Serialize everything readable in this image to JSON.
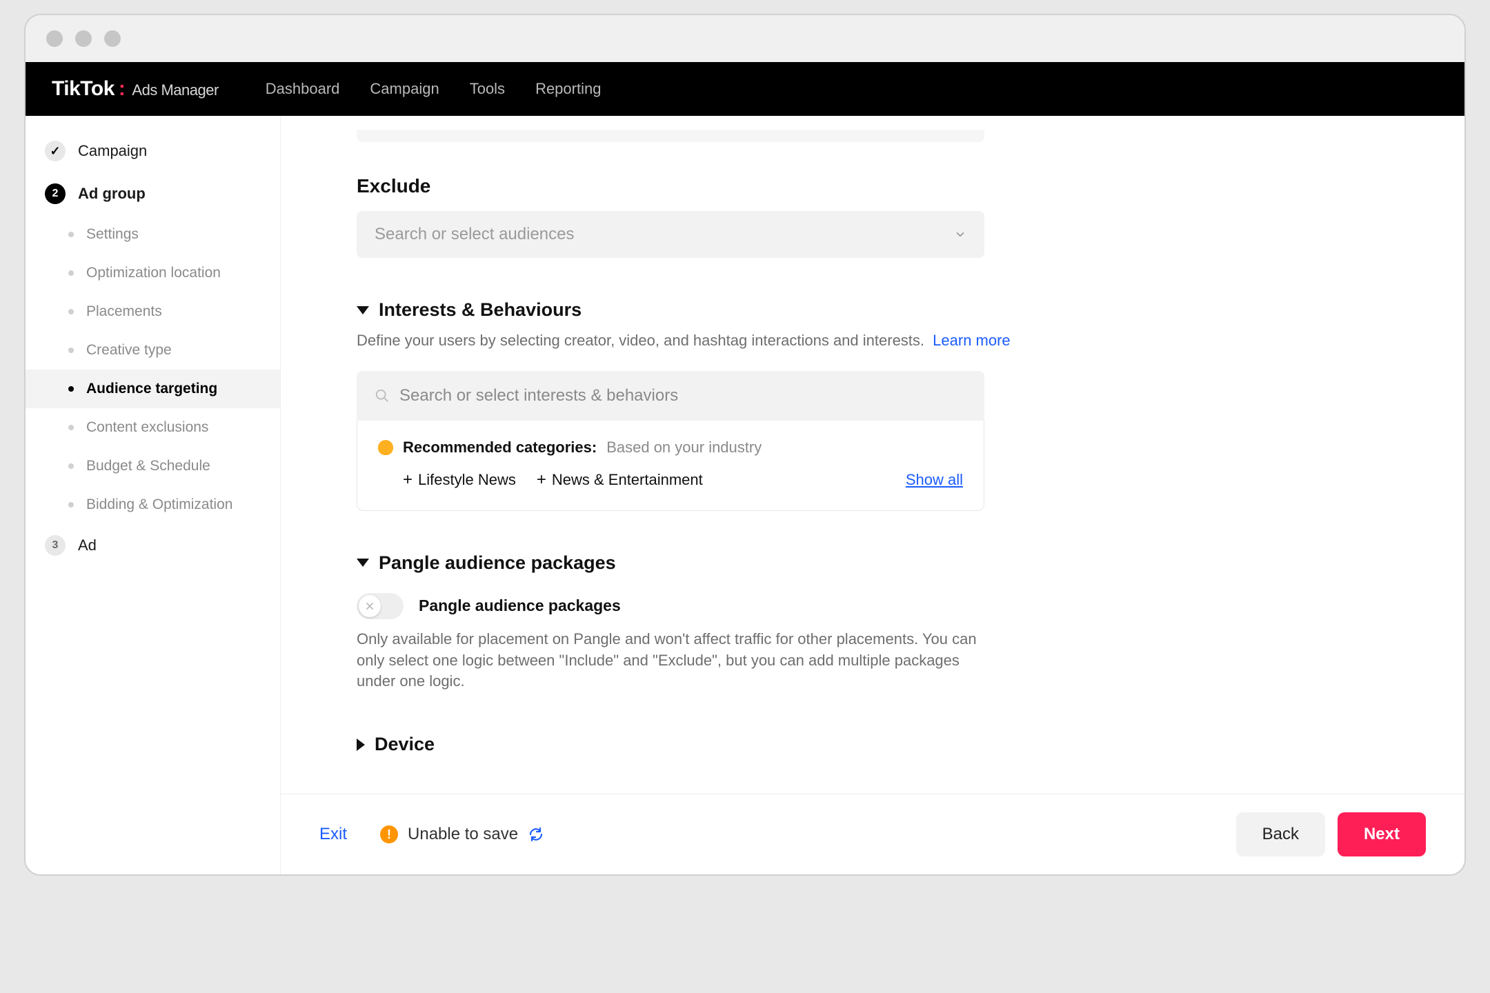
{
  "brand": {
    "name": "TikTok",
    "sub": "Ads Manager"
  },
  "nav": {
    "dashboard": "Dashboard",
    "campaign": "Campaign",
    "tools": "Tools",
    "reporting": "Reporting"
  },
  "sidebar": {
    "campaign": "Campaign",
    "adgroup": "Ad group",
    "adgroup_num": "2",
    "ad_num": "3",
    "subs": {
      "settings": "Settings",
      "optloc": "Optimization location",
      "placements": "Placements",
      "creative": "Creative type",
      "audience": "Audience targeting",
      "content": "Content exclusions",
      "budget": "Budget & Schedule",
      "bidding": "Bidding & Optimization"
    },
    "ad": "Ad"
  },
  "exclude": {
    "title": "Exclude",
    "placeholder": "Search or select audiences"
  },
  "interests": {
    "title": "Interests & Behaviours",
    "desc": "Define your users by selecting creator, video, and hashtag interactions and interests.",
    "learn": "Learn more",
    "search_placeholder": "Search or select interests & behaviors",
    "reco_label": "Recommended categories:",
    "reco_basis": "Based on your industry",
    "chips": {
      "a": "Lifestyle News",
      "b": "News & Entertainment"
    },
    "showall": "Show all"
  },
  "pangle": {
    "title": "Pangle audience packages",
    "toggle_label": "Pangle audience packages",
    "desc": "Only available for placement on Pangle and won't affect traffic for other placements. You can only select one logic between \"Include\" and \"Exclude\", but you can add multiple packages under one logic."
  },
  "device": {
    "title": "Device"
  },
  "footer": {
    "exit": "Exit",
    "warn": "Unable to save",
    "back": "Back",
    "next": "Next"
  }
}
